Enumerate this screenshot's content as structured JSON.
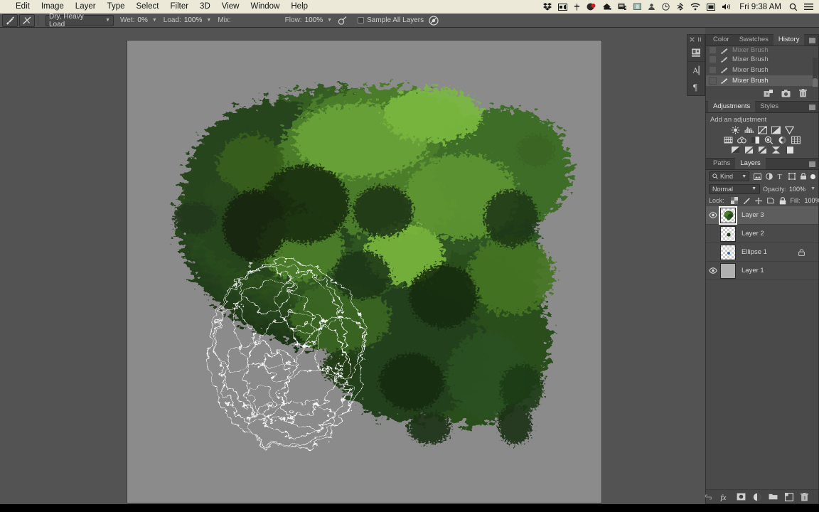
{
  "macbar": {
    "app_menu": "",
    "menus": [
      "Edit",
      "Image",
      "Layer",
      "Type",
      "Select",
      "Filter",
      "3D",
      "View",
      "Window",
      "Help"
    ],
    "status_icons": [
      "dropbox-icon",
      "screen-recorder-icon",
      "antenna-icon",
      "colorsync-icon",
      "dropbox-alt-icon",
      "backup-icon",
      "display-icon",
      "user-icon",
      "timemachine-icon",
      "bluetooth-icon",
      "wifi-icon",
      "screen-icon",
      "volume-icon"
    ],
    "clock": "Fri 9:38 AM",
    "search_icon": "search-icon",
    "notification_icon": "notification-center-icon"
  },
  "optionsbar": {
    "tool_icon": "mixer-brush-tool-icon",
    "preset_icon": "brush-preset-icon",
    "brush_preset": "Dry, Heavy Load",
    "wet_label": "Wet:",
    "wet_value": "0%",
    "load_label": "Load:",
    "load_value": "100%",
    "mix_label": "Mix:",
    "mix_value": "",
    "flow_label": "Flow:",
    "flow_value": "100%",
    "airbrush_icon": "airbrush-icon",
    "sample_all_layers": "Sample All Layers",
    "tablet_pressure_icon": "tablet-pressure-icon"
  },
  "history": {
    "tabs": [
      {
        "label": "Color",
        "active": false
      },
      {
        "label": "Swatches",
        "active": false
      },
      {
        "label": "History",
        "active": true
      }
    ],
    "menu_icon": "panel-menu-icon",
    "items": [
      {
        "label": "Mixer Brush",
        "selected": false,
        "partial": true
      },
      {
        "label": "Mixer Brush",
        "selected": false,
        "partial": false
      },
      {
        "label": "Mixer Brush",
        "selected": false,
        "partial": false
      },
      {
        "label": "Mixer Brush",
        "selected": true,
        "partial": false
      }
    ],
    "footer_icons": [
      "create-document-from-state-icon",
      "create-snapshot-icon",
      "delete-state-icon"
    ]
  },
  "adjustments": {
    "tabs": [
      {
        "label": "Adjustments",
        "active": true
      },
      {
        "label": "Styles",
        "active": false
      }
    ],
    "menu_icon": "panel-menu-icon",
    "title": "Add an adjustment",
    "row1_icons": [
      "brightness-contrast-icon",
      "levels-icon",
      "curves-icon",
      "exposure-icon",
      "vibrance-icon"
    ],
    "row2_icons": [
      "hue-saturation-icon",
      "color-balance-icon",
      "black-white-icon",
      "photo-filter-icon",
      "channel-mixer-icon",
      "color-lookup-icon"
    ],
    "row3_icons": [
      "invert-icon",
      "posterize-icon",
      "threshold-icon",
      "gradient-map-icon",
      "selective-color-icon"
    ]
  },
  "layers": {
    "tabs": [
      {
        "label": "Paths",
        "active": false
      },
      {
        "label": "Layers",
        "active": true
      }
    ],
    "menu_icon": "panel-menu-icon",
    "filter": {
      "search_icon": "search-icon",
      "kind_label": "Kind",
      "type_icons": [
        "filter-pixel-icon",
        "filter-adjustment-icon",
        "filter-type-icon",
        "filter-shape-icon",
        "filter-smartobject-icon"
      ],
      "toggle_icon": "filter-enable-toggle"
    },
    "blend_mode": "Normal",
    "opacity_label": "Opacity:",
    "opacity_value": "100%",
    "lock_label": "Lock:",
    "lock_icons": [
      "lock-transparent-pixels-icon",
      "lock-image-pixels-icon",
      "lock-position-icon",
      "lock-artboard-icon",
      "lock-all-icon"
    ],
    "fill_label": "Fill:",
    "fill_value": "100%",
    "rows": [
      {
        "name": "Layer 3",
        "visible": true,
        "selected": true,
        "locked": false,
        "thumb": "foliage"
      },
      {
        "name": "Layer 2",
        "visible": false,
        "selected": false,
        "locked": false,
        "thumb": "dot-dark"
      },
      {
        "name": "Ellipse 1",
        "visible": false,
        "selected": false,
        "locked": true,
        "thumb": "dot-blue"
      },
      {
        "name": "Layer 1",
        "visible": true,
        "selected": false,
        "locked": false,
        "thumb": "solid-gray"
      }
    ],
    "footer_icons": [
      "link-layers-icon",
      "layer-style-fx-icon",
      "add-layer-mask-icon",
      "new-adjustment-layer-icon",
      "new-group-icon",
      "new-layer-icon",
      "delete-layer-icon"
    ]
  },
  "colors": {
    "menubar_bg": "#ece9d8",
    "panel_bg": "#4a4a4a",
    "workspace_bg": "#535353",
    "canvas_bg": "#8b8b8b",
    "options_bg": "#535353",
    "selected_row": "#5d5d5d",
    "foliage_green": "#4e7c2a",
    "foliage_dark": "#1d3318"
  },
  "canvas": {
    "artwork_name": "painted-tree-foliage",
    "selection_name": "marching-ants-selection"
  }
}
